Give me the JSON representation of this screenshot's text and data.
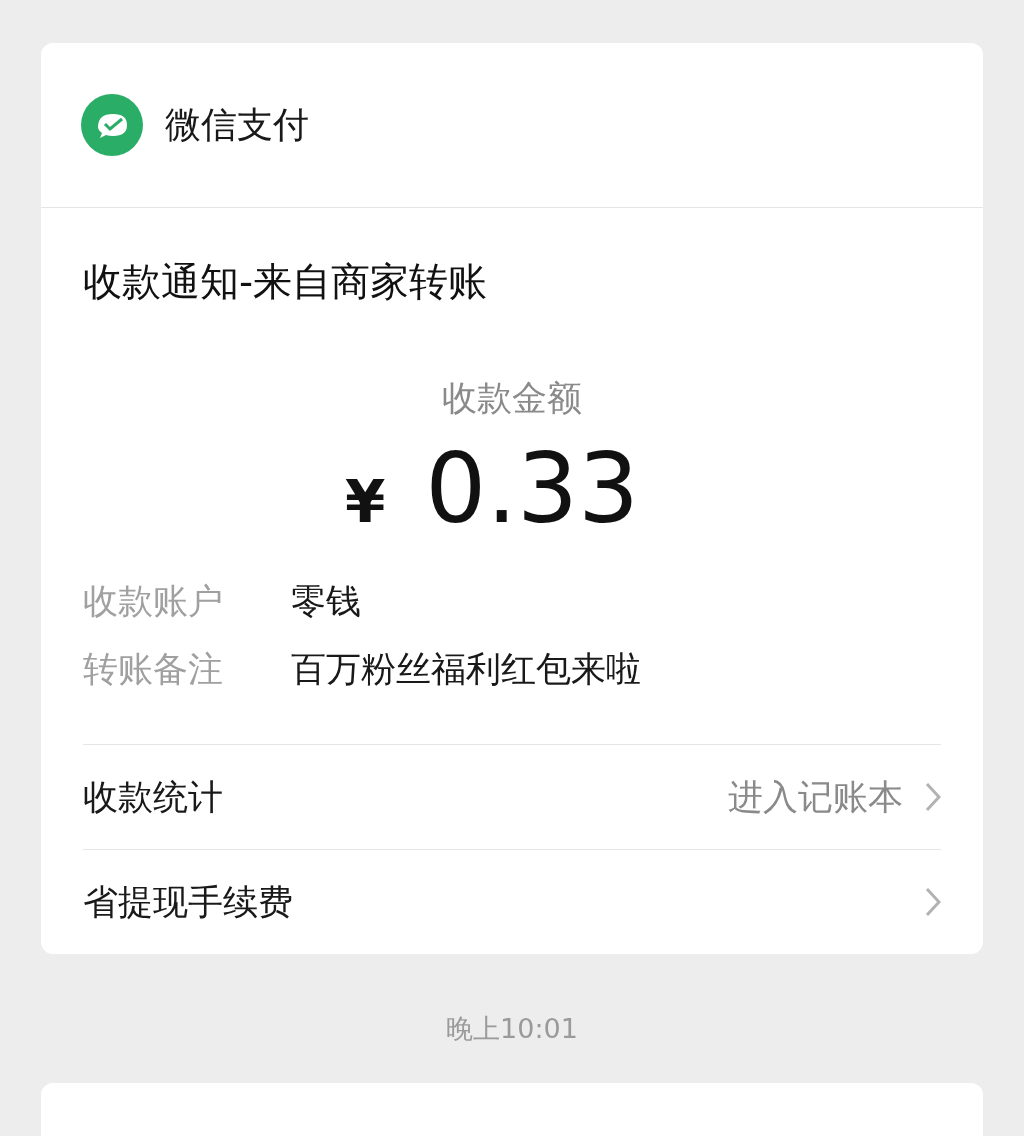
{
  "card": {
    "app_name": "微信支付",
    "title": "收款通知-来自商家转账",
    "amount_label": "收款金额",
    "currency": "¥",
    "amount": "0.33",
    "details": [
      {
        "label": "收款账户",
        "value": "零钱"
      },
      {
        "label": "转账备注",
        "value": "百万粉丝福利红包来啦"
      }
    ],
    "links": [
      {
        "label": "收款统计",
        "hint": "进入记账本"
      },
      {
        "label": "省提现手续费"
      }
    ]
  },
  "timestamp": "晚上10:01"
}
